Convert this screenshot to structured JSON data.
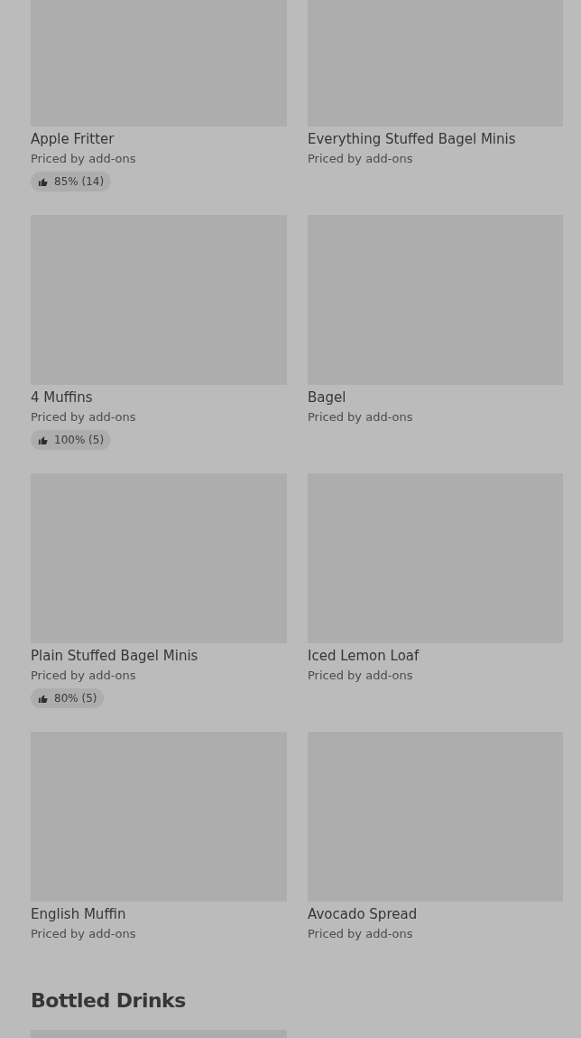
{
  "sections": [
    {
      "items": [
        {
          "name": "Apple Fritter",
          "price": "Priced by add-ons",
          "rating": "85% (14)"
        },
        {
          "name": "Everything Stuffed Bagel Minis",
          "price": "Priced by add-ons"
        },
        {
          "name": "4 Muffins",
          "price": "Priced by add-ons",
          "rating": "100% (5)"
        },
        {
          "name": "Bagel",
          "price": "Priced by add-ons"
        },
        {
          "name": "Plain Stuffed Bagel Minis",
          "price": "Priced by add-ons",
          "rating": "80% (5)"
        },
        {
          "name": "Iced Lemon Loaf",
          "price": "Priced by add-ons"
        },
        {
          "name": "English Muffin",
          "price": "Priced by add-ons"
        },
        {
          "name": "Avocado Spread",
          "price": "Priced by add-ons"
        }
      ]
    },
    {
      "title": "Bottled Drinks"
    }
  ]
}
